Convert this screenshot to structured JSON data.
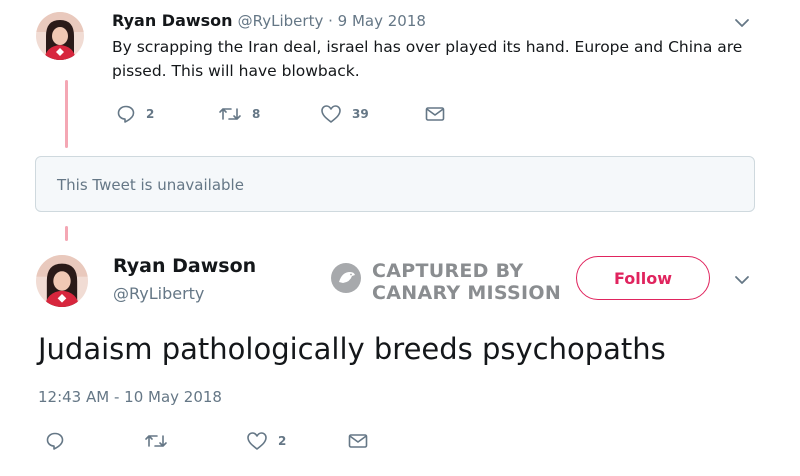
{
  "first_tweet": {
    "author_name": "Ryan Dawson",
    "handle_date": "@RyLiberty · 9 May 2018",
    "text": "By scrapping the Iran deal, israel has over played its hand. Europe and China are pissed. This will have blowback.",
    "reply_count": "2",
    "retweet_count": "8",
    "like_count": "39"
  },
  "unavailable_tweet": {
    "text": "This Tweet is unavailable"
  },
  "main_tweet": {
    "author_name": "Ryan Dawson",
    "handle": "@RyLiberty",
    "follow_label": "Follow",
    "text": "Judaism pathologically breeds psychopaths",
    "timestamp": "12:43 AM - 10 May 2018",
    "like_count": "2"
  },
  "watermark": {
    "line1": "CAPTURED BY",
    "line2": "CANARY MISSION"
  },
  "colors": {
    "accent_pink": "#e0245e",
    "thread_line": "#f4a7b4",
    "muted_gray": "#657786"
  },
  "icons": [
    "reply-icon",
    "retweet-icon",
    "like-icon",
    "dm-icon",
    "chevron-down-icon",
    "canary-logo-icon"
  ]
}
